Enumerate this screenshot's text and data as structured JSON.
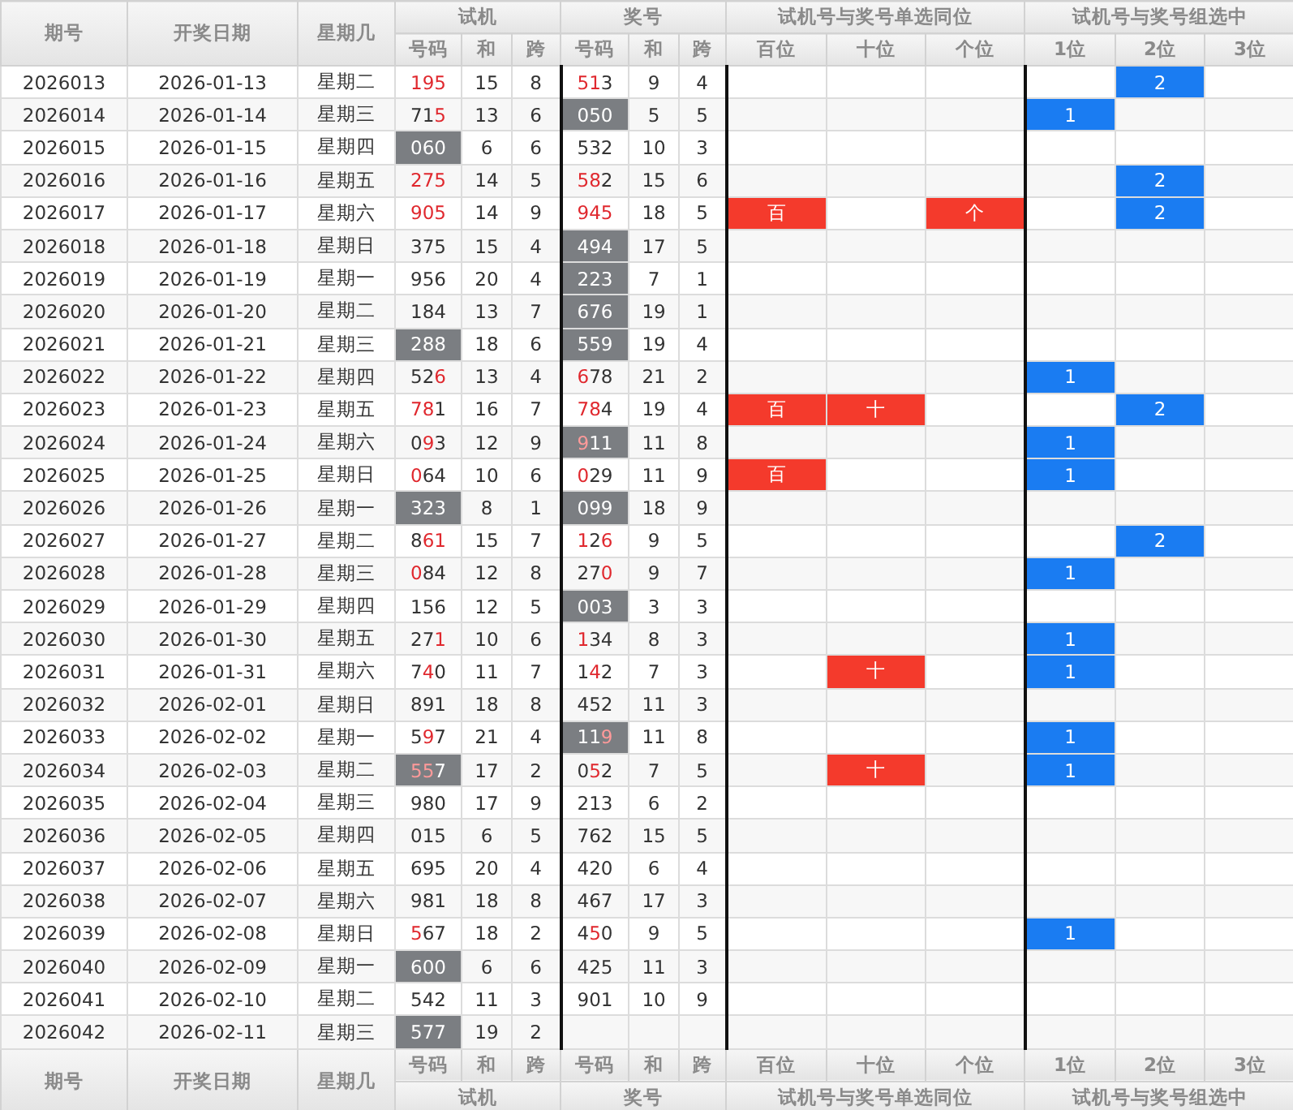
{
  "header": {
    "groups": [
      {
        "label": "期号"
      },
      {
        "label": "开奖日期"
      },
      {
        "label": "星期几"
      },
      {
        "label": "试机"
      },
      {
        "label": "奖号"
      },
      {
        "label": "试机号与奖号单选同位"
      },
      {
        "label": "试机号与奖号组选中"
      }
    ],
    "subcolumns": [
      "号码",
      "和",
      "跨",
      "号码",
      "和",
      "跨",
      "百位",
      "十位",
      "个位",
      "1位",
      "2位",
      "3位"
    ]
  },
  "rows": [
    {
      "issue": "2026013",
      "date": "2026-01-13",
      "weekday": "星期二",
      "trial": {
        "number": "195",
        "hits": [
          true,
          true,
          true
        ],
        "highlighted": false
      },
      "trial_sum": "15",
      "trial_span": "8",
      "prize": {
        "number": "513",
        "hits": [
          true,
          true,
          false
        ],
        "highlighted": false
      },
      "prize_sum": "9",
      "prize_span": "4",
      "position": [
        {
          "marked": false
        },
        {
          "marked": false
        },
        {
          "marked": false
        }
      ],
      "group": [
        {
          "marked": false
        },
        {
          "marked": true,
          "label": "2"
        },
        {
          "marked": false
        }
      ]
    },
    {
      "issue": "2026014",
      "date": "2026-01-14",
      "weekday": "星期三",
      "trial": {
        "number": "715",
        "hits": [
          false,
          false,
          true
        ],
        "highlighted": false
      },
      "trial_sum": "13",
      "trial_span": "6",
      "prize": {
        "number": "050",
        "hits": [
          false,
          false,
          false
        ],
        "highlighted": true
      },
      "prize_sum": "5",
      "prize_span": "5",
      "position": [
        {
          "marked": false
        },
        {
          "marked": false
        },
        {
          "marked": false
        }
      ],
      "group": [
        {
          "marked": true,
          "label": "1"
        },
        {
          "marked": false
        },
        {
          "marked": false
        }
      ]
    },
    {
      "issue": "2026015",
      "date": "2026-01-15",
      "weekday": "星期四",
      "trial": {
        "number": "060",
        "hits": [
          false,
          false,
          false
        ],
        "highlighted": true
      },
      "trial_sum": "6",
      "trial_span": "6",
      "prize": {
        "number": "532",
        "hits": [
          false,
          false,
          false
        ],
        "highlighted": false
      },
      "prize_sum": "10",
      "prize_span": "3",
      "position": [
        {
          "marked": false
        },
        {
          "marked": false
        },
        {
          "marked": false
        }
      ],
      "group": [
        {
          "marked": false
        },
        {
          "marked": false
        },
        {
          "marked": false
        }
      ]
    },
    {
      "issue": "2026016",
      "date": "2026-01-16",
      "weekday": "星期五",
      "trial": {
        "number": "275",
        "hits": [
          true,
          true,
          true
        ],
        "highlighted": false
      },
      "trial_sum": "14",
      "trial_span": "5",
      "prize": {
        "number": "582",
        "hits": [
          true,
          true,
          false
        ],
        "highlighted": false
      },
      "prize_sum": "15",
      "prize_span": "6",
      "position": [
        {
          "marked": false
        },
        {
          "marked": false
        },
        {
          "marked": false
        }
      ],
      "group": [
        {
          "marked": false
        },
        {
          "marked": true,
          "label": "2"
        },
        {
          "marked": false
        }
      ]
    },
    {
      "issue": "2026017",
      "date": "2026-01-17",
      "weekday": "星期六",
      "trial": {
        "number": "905",
        "hits": [
          true,
          true,
          true
        ],
        "highlighted": false
      },
      "trial_sum": "14",
      "trial_span": "9",
      "prize": {
        "number": "945",
        "hits": [
          true,
          true,
          true
        ],
        "highlighted": false
      },
      "prize_sum": "18",
      "prize_span": "5",
      "position": [
        {
          "marked": true,
          "label": "百"
        },
        {
          "marked": false
        },
        {
          "marked": true,
          "label": "个"
        }
      ],
      "group": [
        {
          "marked": false
        },
        {
          "marked": true,
          "label": "2"
        },
        {
          "marked": false
        }
      ]
    },
    {
      "issue": "2026018",
      "date": "2026-01-18",
      "weekday": "星期日",
      "trial": {
        "number": "375",
        "hits": [
          false,
          false,
          false
        ],
        "highlighted": false
      },
      "trial_sum": "15",
      "trial_span": "4",
      "prize": {
        "number": "494",
        "hits": [
          false,
          false,
          false
        ],
        "highlighted": true
      },
      "prize_sum": "17",
      "prize_span": "5",
      "position": [
        {
          "marked": false
        },
        {
          "marked": false
        },
        {
          "marked": false
        }
      ],
      "group": [
        {
          "marked": false
        },
        {
          "marked": false
        },
        {
          "marked": false
        }
      ]
    },
    {
      "issue": "2026019",
      "date": "2026-01-19",
      "weekday": "星期一",
      "trial": {
        "number": "956",
        "hits": [
          false,
          false,
          false
        ],
        "highlighted": false
      },
      "trial_sum": "20",
      "trial_span": "4",
      "prize": {
        "number": "223",
        "hits": [
          false,
          false,
          false
        ],
        "highlighted": true
      },
      "prize_sum": "7",
      "prize_span": "1",
      "position": [
        {
          "marked": false
        },
        {
          "marked": false
        },
        {
          "marked": false
        }
      ],
      "group": [
        {
          "marked": false
        },
        {
          "marked": false
        },
        {
          "marked": false
        }
      ]
    },
    {
      "issue": "2026020",
      "date": "2026-01-20",
      "weekday": "星期二",
      "trial": {
        "number": "184",
        "hits": [
          false,
          false,
          false
        ],
        "highlighted": false
      },
      "trial_sum": "13",
      "trial_span": "7",
      "prize": {
        "number": "676",
        "hits": [
          false,
          false,
          false
        ],
        "highlighted": true
      },
      "prize_sum": "19",
      "prize_span": "1",
      "position": [
        {
          "marked": false
        },
        {
          "marked": false
        },
        {
          "marked": false
        }
      ],
      "group": [
        {
          "marked": false
        },
        {
          "marked": false
        },
        {
          "marked": false
        }
      ]
    },
    {
      "issue": "2026021",
      "date": "2026-01-21",
      "weekday": "星期三",
      "trial": {
        "number": "288",
        "hits": [
          false,
          false,
          false
        ],
        "highlighted": true
      },
      "trial_sum": "18",
      "trial_span": "6",
      "prize": {
        "number": "559",
        "hits": [
          false,
          false,
          false
        ],
        "highlighted": true
      },
      "prize_sum": "19",
      "prize_span": "4",
      "position": [
        {
          "marked": false
        },
        {
          "marked": false
        },
        {
          "marked": false
        }
      ],
      "group": [
        {
          "marked": false
        },
        {
          "marked": false
        },
        {
          "marked": false
        }
      ]
    },
    {
      "issue": "2026022",
      "date": "2026-01-22",
      "weekday": "星期四",
      "trial": {
        "number": "526",
        "hits": [
          false,
          false,
          true
        ],
        "highlighted": false
      },
      "trial_sum": "13",
      "trial_span": "4",
      "prize": {
        "number": "678",
        "hits": [
          true,
          false,
          false
        ],
        "highlighted": false
      },
      "prize_sum": "21",
      "prize_span": "2",
      "position": [
        {
          "marked": false
        },
        {
          "marked": false
        },
        {
          "marked": false
        }
      ],
      "group": [
        {
          "marked": true,
          "label": "1"
        },
        {
          "marked": false
        },
        {
          "marked": false
        }
      ]
    },
    {
      "issue": "2026023",
      "date": "2026-01-23",
      "weekday": "星期五",
      "trial": {
        "number": "781",
        "hits": [
          true,
          true,
          false
        ],
        "highlighted": false
      },
      "trial_sum": "16",
      "trial_span": "7",
      "prize": {
        "number": "784",
        "hits": [
          true,
          true,
          false
        ],
        "highlighted": false
      },
      "prize_sum": "19",
      "prize_span": "4",
      "position": [
        {
          "marked": true,
          "label": "百"
        },
        {
          "marked": true,
          "label": "十"
        },
        {
          "marked": false
        }
      ],
      "group": [
        {
          "marked": false
        },
        {
          "marked": true,
          "label": "2"
        },
        {
          "marked": false
        }
      ]
    },
    {
      "issue": "2026024",
      "date": "2026-01-24",
      "weekday": "星期六",
      "trial": {
        "number": "093",
        "hits": [
          false,
          true,
          false
        ],
        "highlighted": false
      },
      "trial_sum": "12",
      "trial_span": "9",
      "prize": {
        "number": "911",
        "hits": [
          true,
          false,
          false
        ],
        "highlighted": true
      },
      "prize_sum": "11",
      "prize_span": "8",
      "position": [
        {
          "marked": false
        },
        {
          "marked": false
        },
        {
          "marked": false
        }
      ],
      "group": [
        {
          "marked": true,
          "label": "1"
        },
        {
          "marked": false
        },
        {
          "marked": false
        }
      ]
    },
    {
      "issue": "2026025",
      "date": "2026-01-25",
      "weekday": "星期日",
      "trial": {
        "number": "064",
        "hits": [
          true,
          false,
          false
        ],
        "highlighted": false
      },
      "trial_sum": "10",
      "trial_span": "6",
      "prize": {
        "number": "029",
        "hits": [
          true,
          false,
          false
        ],
        "highlighted": false
      },
      "prize_sum": "11",
      "prize_span": "9",
      "position": [
        {
          "marked": true,
          "label": "百"
        },
        {
          "marked": false
        },
        {
          "marked": false
        }
      ],
      "group": [
        {
          "marked": true,
          "label": "1"
        },
        {
          "marked": false
        },
        {
          "marked": false
        }
      ]
    },
    {
      "issue": "2026026",
      "date": "2026-01-26",
      "weekday": "星期一",
      "trial": {
        "number": "323",
        "hits": [
          false,
          false,
          false
        ],
        "highlighted": true
      },
      "trial_sum": "8",
      "trial_span": "1",
      "prize": {
        "number": "099",
        "hits": [
          false,
          false,
          false
        ],
        "highlighted": true
      },
      "prize_sum": "18",
      "prize_span": "9",
      "position": [
        {
          "marked": false
        },
        {
          "marked": false
        },
        {
          "marked": false
        }
      ],
      "group": [
        {
          "marked": false
        },
        {
          "marked": false
        },
        {
          "marked": false
        }
      ]
    },
    {
      "issue": "2026027",
      "date": "2026-01-27",
      "weekday": "星期二",
      "trial": {
        "number": "861",
        "hits": [
          false,
          true,
          true
        ],
        "highlighted": false
      },
      "trial_sum": "15",
      "trial_span": "7",
      "prize": {
        "number": "126",
        "hits": [
          true,
          false,
          true
        ],
        "highlighted": false
      },
      "prize_sum": "9",
      "prize_span": "5",
      "position": [
        {
          "marked": false
        },
        {
          "marked": false
        },
        {
          "marked": false
        }
      ],
      "group": [
        {
          "marked": false
        },
        {
          "marked": true,
          "label": "2"
        },
        {
          "marked": false
        }
      ]
    },
    {
      "issue": "2026028",
      "date": "2026-01-28",
      "weekday": "星期三",
      "trial": {
        "number": "084",
        "hits": [
          true,
          false,
          false
        ],
        "highlighted": false
      },
      "trial_sum": "12",
      "trial_span": "8",
      "prize": {
        "number": "270",
        "hits": [
          false,
          false,
          true
        ],
        "highlighted": false
      },
      "prize_sum": "9",
      "prize_span": "7",
      "position": [
        {
          "marked": false
        },
        {
          "marked": false
        },
        {
          "marked": false
        }
      ],
      "group": [
        {
          "marked": true,
          "label": "1"
        },
        {
          "marked": false
        },
        {
          "marked": false
        }
      ]
    },
    {
      "issue": "2026029",
      "date": "2026-01-29",
      "weekday": "星期四",
      "trial": {
        "number": "156",
        "hits": [
          false,
          false,
          false
        ],
        "highlighted": false
      },
      "trial_sum": "12",
      "trial_span": "5",
      "prize": {
        "number": "003",
        "hits": [
          false,
          false,
          false
        ],
        "highlighted": true
      },
      "prize_sum": "3",
      "prize_span": "3",
      "position": [
        {
          "marked": false
        },
        {
          "marked": false
        },
        {
          "marked": false
        }
      ],
      "group": [
        {
          "marked": false
        },
        {
          "marked": false
        },
        {
          "marked": false
        }
      ]
    },
    {
      "issue": "2026030",
      "date": "2026-01-30",
      "weekday": "星期五",
      "trial": {
        "number": "271",
        "hits": [
          false,
          false,
          true
        ],
        "highlighted": false
      },
      "trial_sum": "10",
      "trial_span": "6",
      "prize": {
        "number": "134",
        "hits": [
          true,
          false,
          false
        ],
        "highlighted": false
      },
      "prize_sum": "8",
      "prize_span": "3",
      "position": [
        {
          "marked": false
        },
        {
          "marked": false
        },
        {
          "marked": false
        }
      ],
      "group": [
        {
          "marked": true,
          "label": "1"
        },
        {
          "marked": false
        },
        {
          "marked": false
        }
      ]
    },
    {
      "issue": "2026031",
      "date": "2026-01-31",
      "weekday": "星期六",
      "trial": {
        "number": "740",
        "hits": [
          false,
          true,
          false
        ],
        "highlighted": false
      },
      "trial_sum": "11",
      "trial_span": "7",
      "prize": {
        "number": "142",
        "hits": [
          false,
          true,
          false
        ],
        "highlighted": false
      },
      "prize_sum": "7",
      "prize_span": "3",
      "position": [
        {
          "marked": false
        },
        {
          "marked": true,
          "label": "十"
        },
        {
          "marked": false
        }
      ],
      "group": [
        {
          "marked": true,
          "label": "1"
        },
        {
          "marked": false
        },
        {
          "marked": false
        }
      ]
    },
    {
      "issue": "2026032",
      "date": "2026-02-01",
      "weekday": "星期日",
      "trial": {
        "number": "891",
        "hits": [
          false,
          false,
          false
        ],
        "highlighted": false
      },
      "trial_sum": "18",
      "trial_span": "8",
      "prize": {
        "number": "452",
        "hits": [
          false,
          false,
          false
        ],
        "highlighted": false
      },
      "prize_sum": "11",
      "prize_span": "3",
      "position": [
        {
          "marked": false
        },
        {
          "marked": false
        },
        {
          "marked": false
        }
      ],
      "group": [
        {
          "marked": false
        },
        {
          "marked": false
        },
        {
          "marked": false
        }
      ]
    },
    {
      "issue": "2026033",
      "date": "2026-02-02",
      "weekday": "星期一",
      "trial": {
        "number": "597",
        "hits": [
          false,
          true,
          false
        ],
        "highlighted": false
      },
      "trial_sum": "21",
      "trial_span": "4",
      "prize": {
        "number": "119",
        "hits": [
          false,
          false,
          true
        ],
        "highlighted": true
      },
      "prize_sum": "11",
      "prize_span": "8",
      "position": [
        {
          "marked": false
        },
        {
          "marked": false
        },
        {
          "marked": false
        }
      ],
      "group": [
        {
          "marked": true,
          "label": "1"
        },
        {
          "marked": false
        },
        {
          "marked": false
        }
      ]
    },
    {
      "issue": "2026034",
      "date": "2026-02-03",
      "weekday": "星期二",
      "trial": {
        "number": "557",
        "hits": [
          true,
          true,
          false
        ],
        "highlighted": true
      },
      "trial_sum": "17",
      "trial_span": "2",
      "prize": {
        "number": "052",
        "hits": [
          false,
          true,
          false
        ],
        "highlighted": false
      },
      "prize_sum": "7",
      "prize_span": "5",
      "position": [
        {
          "marked": false
        },
        {
          "marked": true,
          "label": "十"
        },
        {
          "marked": false
        }
      ],
      "group": [
        {
          "marked": true,
          "label": "1"
        },
        {
          "marked": false
        },
        {
          "marked": false
        }
      ]
    },
    {
      "issue": "2026035",
      "date": "2026-02-04",
      "weekday": "星期三",
      "trial": {
        "number": "980",
        "hits": [
          false,
          false,
          false
        ],
        "highlighted": false
      },
      "trial_sum": "17",
      "trial_span": "9",
      "prize": {
        "number": "213",
        "hits": [
          false,
          false,
          false
        ],
        "highlighted": false
      },
      "prize_sum": "6",
      "prize_span": "2",
      "position": [
        {
          "marked": false
        },
        {
          "marked": false
        },
        {
          "marked": false
        }
      ],
      "group": [
        {
          "marked": false
        },
        {
          "marked": false
        },
        {
          "marked": false
        }
      ]
    },
    {
      "issue": "2026036",
      "date": "2026-02-05",
      "weekday": "星期四",
      "trial": {
        "number": "015",
        "hits": [
          false,
          false,
          false
        ],
        "highlighted": false
      },
      "trial_sum": "6",
      "trial_span": "5",
      "prize": {
        "number": "762",
        "hits": [
          false,
          false,
          false
        ],
        "highlighted": false
      },
      "prize_sum": "15",
      "prize_span": "5",
      "position": [
        {
          "marked": false
        },
        {
          "marked": false
        },
        {
          "marked": false
        }
      ],
      "group": [
        {
          "marked": false
        },
        {
          "marked": false
        },
        {
          "marked": false
        }
      ]
    },
    {
      "issue": "2026037",
      "date": "2026-02-06",
      "weekday": "星期五",
      "trial": {
        "number": "695",
        "hits": [
          false,
          false,
          false
        ],
        "highlighted": false
      },
      "trial_sum": "20",
      "trial_span": "4",
      "prize": {
        "number": "420",
        "hits": [
          false,
          false,
          false
        ],
        "highlighted": false
      },
      "prize_sum": "6",
      "prize_span": "4",
      "position": [
        {
          "marked": false
        },
        {
          "marked": false
        },
        {
          "marked": false
        }
      ],
      "group": [
        {
          "marked": false
        },
        {
          "marked": false
        },
        {
          "marked": false
        }
      ]
    },
    {
      "issue": "2026038",
      "date": "2026-02-07",
      "weekday": "星期六",
      "trial": {
        "number": "981",
        "hits": [
          false,
          false,
          false
        ],
        "highlighted": false
      },
      "trial_sum": "18",
      "trial_span": "8",
      "prize": {
        "number": "467",
        "hits": [
          false,
          false,
          false
        ],
        "highlighted": false
      },
      "prize_sum": "17",
      "prize_span": "3",
      "position": [
        {
          "marked": false
        },
        {
          "marked": false
        },
        {
          "marked": false
        }
      ],
      "group": [
        {
          "marked": false
        },
        {
          "marked": false
        },
        {
          "marked": false
        }
      ]
    },
    {
      "issue": "2026039",
      "date": "2026-02-08",
      "weekday": "星期日",
      "trial": {
        "number": "567",
        "hits": [
          true,
          false,
          false
        ],
        "highlighted": false
      },
      "trial_sum": "18",
      "trial_span": "2",
      "prize": {
        "number": "450",
        "hits": [
          false,
          true,
          false
        ],
        "highlighted": false
      },
      "prize_sum": "9",
      "prize_span": "5",
      "position": [
        {
          "marked": false
        },
        {
          "marked": false
        },
        {
          "marked": false
        }
      ],
      "group": [
        {
          "marked": true,
          "label": "1"
        },
        {
          "marked": false
        },
        {
          "marked": false
        }
      ]
    },
    {
      "issue": "2026040",
      "date": "2026-02-09",
      "weekday": "星期一",
      "trial": {
        "number": "600",
        "hits": [
          false,
          false,
          false
        ],
        "highlighted": true
      },
      "trial_sum": "6",
      "trial_span": "6",
      "prize": {
        "number": "425",
        "hits": [
          false,
          false,
          false
        ],
        "highlighted": false
      },
      "prize_sum": "11",
      "prize_span": "3",
      "position": [
        {
          "marked": false
        },
        {
          "marked": false
        },
        {
          "marked": false
        }
      ],
      "group": [
        {
          "marked": false
        },
        {
          "marked": false
        },
        {
          "marked": false
        }
      ]
    },
    {
      "issue": "2026041",
      "date": "2026-02-10",
      "weekday": "星期二",
      "trial": {
        "number": "542",
        "hits": [
          false,
          false,
          false
        ],
        "highlighted": false
      },
      "trial_sum": "11",
      "trial_span": "3",
      "prize": {
        "number": "901",
        "hits": [
          false,
          false,
          false
        ],
        "highlighted": false
      },
      "prize_sum": "10",
      "prize_span": "9",
      "position": [
        {
          "marked": false
        },
        {
          "marked": false
        },
        {
          "marked": false
        }
      ],
      "group": [
        {
          "marked": false
        },
        {
          "marked": false
        },
        {
          "marked": false
        }
      ]
    },
    {
      "issue": "2026042",
      "date": "2026-02-11",
      "weekday": "星期三",
      "trial": {
        "number": "577",
        "hits": [
          false,
          false,
          false
        ],
        "highlighted": true
      },
      "trial_sum": "19",
      "trial_span": "2",
      "position": [
        {
          "marked": false
        },
        {
          "marked": false
        },
        {
          "marked": false
        }
      ],
      "group": [
        {
          "marked": false
        },
        {
          "marked": false
        },
        {
          "marked": false
        }
      ]
    }
  ],
  "footer": {
    "groups": [
      {
        "label": "期号"
      },
      {
        "label": "开奖日期"
      },
      {
        "label": "星期几"
      },
      {
        "label": "试机"
      },
      {
        "label": "奖号"
      },
      {
        "label": "试机号与奖号单选同位"
      },
      {
        "label": "试机号与奖号组选中"
      }
    ],
    "subcolumns": [
      "号码",
      "和",
      "跨",
      "号码",
      "和",
      "跨",
      "百位",
      "十位",
      "个位",
      "1位",
      "2位",
      "3位"
    ]
  }
}
